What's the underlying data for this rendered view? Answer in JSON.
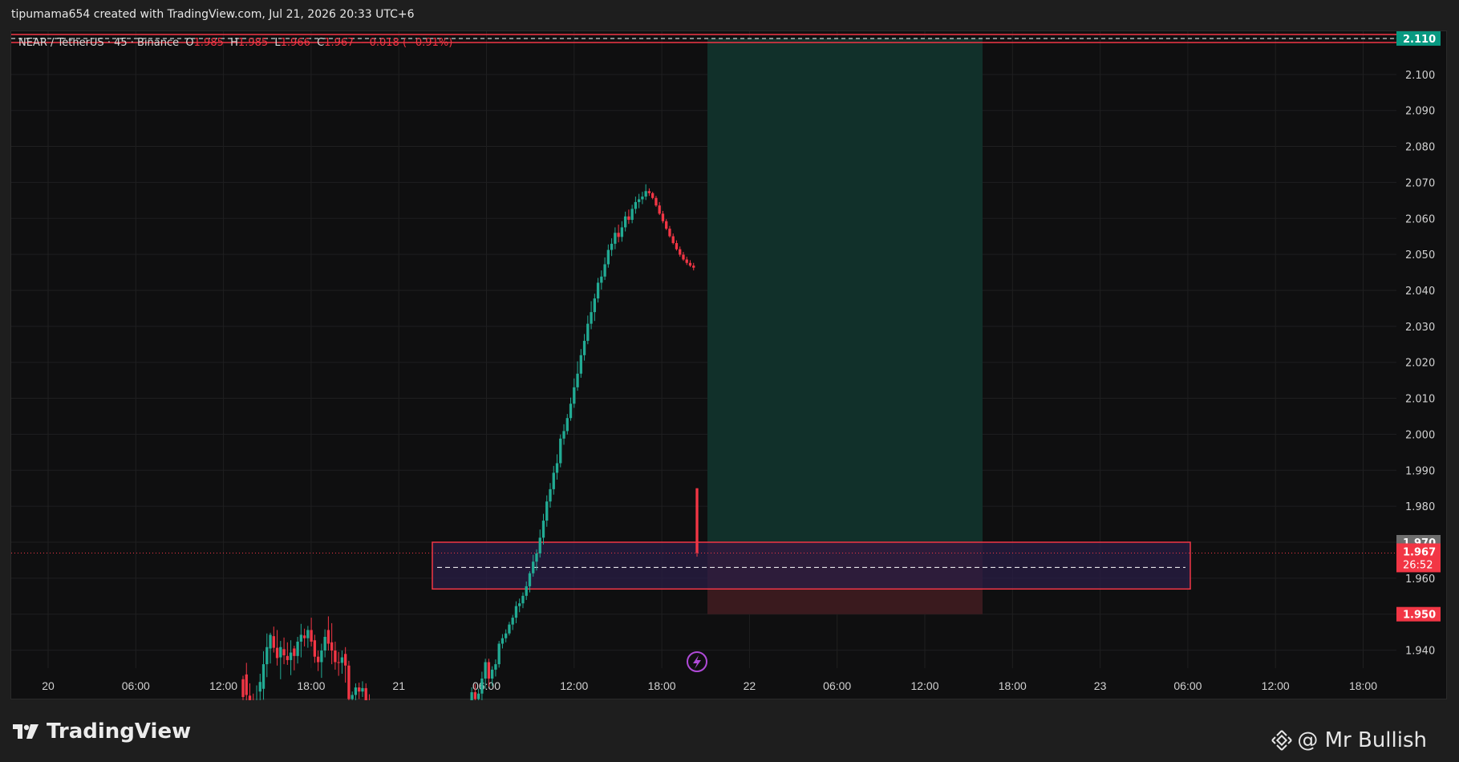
{
  "header": {
    "credit": "tipumama654 created with TradingView.com, Jul 21, 2026 20:33 UTC+6"
  },
  "legend": {
    "symbol": "NEAR / TetherUS · 45 · Binance",
    "open_label": "O",
    "open": "1.985",
    "high_label": "H",
    "high": "1.985",
    "low_label": "L",
    "low": "1.966",
    "close_label": "C",
    "close": "1.967",
    "change": "−0.018 (−0.91%)"
  },
  "footer": {
    "logo_text": "TradingView",
    "watermark": "@ Mr Bullish"
  },
  "colors": {
    "up": "#22ab94",
    "down": "#f23645",
    "bg": "#0f0f10",
    "grid": "#1f1f20",
    "target_zone": "#11302a",
    "stop_zone": "#3a1a1e",
    "box_border": "#f23645",
    "box_fill": "#2a1e44"
  },
  "chart_data": {
    "type": "candlestick",
    "symbol": "NEAR / TetherUS",
    "interval": "45",
    "exchange": "Binance",
    "ylim": [
      1.935,
      2.112
    ],
    "y_ticks": [
      "1.940",
      "1.950",
      "1.960",
      "1.970",
      "1.980",
      "1.990",
      "2.000",
      "2.010",
      "2.020",
      "2.030",
      "2.040",
      "2.050",
      "2.060",
      "2.070",
      "2.080",
      "2.090",
      "2.100",
      "2.110"
    ],
    "x_ticks": [
      "20",
      "06:00",
      "12:00",
      "18:00",
      "21",
      "06:00",
      "12:00",
      "18:00",
      "22",
      "06:00",
      "12:00",
      "18:00",
      "23",
      "06:00",
      "12:00",
      "18:00"
    ],
    "candles": [
      [
        1.9348,
        1.9353,
        1.9295,
        1.9322
      ],
      [
        1.9355,
        1.9372,
        1.9307,
        1.9325
      ],
      [
        1.9324,
        1.9342,
        1.9291,
        1.9313
      ],
      [
        1.9309,
        1.9327,
        1.9269,
        1.9294
      ],
      [
        1.9309,
        1.9339,
        1.9262,
        1.9313
      ],
      [
        1.933,
        1.9356,
        1.93,
        1.9344
      ],
      [
        1.9334,
        1.9389,
        1.9318,
        1.937
      ],
      [
        1.937,
        1.9415,
        1.9351,
        1.9395
      ],
      [
        1.9393,
        1.9416,
        1.9371,
        1.9413
      ],
      [
        1.9411,
        1.9425,
        1.9387,
        1.9394
      ],
      [
        1.9394,
        1.942,
        1.9368,
        1.9379
      ],
      [
        1.938,
        1.9404,
        1.9348,
        1.9395
      ],
      [
        1.9392,
        1.9409,
        1.937,
        1.9383
      ],
      [
        1.9382,
        1.9402,
        1.9369,
        1.9376
      ],
      [
        1.9376,
        1.9405,
        1.9354,
        1.9387
      ],
      [
        1.9393,
        1.9397,
        1.9361,
        1.9382
      ],
      [
        1.9382,
        1.941,
        1.9371,
        1.9403
      ],
      [
        1.9403,
        1.9429,
        1.938,
        1.9413
      ],
      [
        1.9412,
        1.9422,
        1.9396,
        1.9408
      ],
      [
        1.9408,
        1.9426,
        1.9394,
        1.942
      ],
      [
        1.942,
        1.9438,
        1.9396,
        1.9403
      ],
      [
        1.9405,
        1.9413,
        1.9372,
        1.9381
      ],
      [
        1.9381,
        1.939,
        1.936,
        1.9373
      ],
      [
        1.9373,
        1.94,
        1.935,
        1.939
      ],
      [
        1.939,
        1.9421,
        1.938,
        1.941
      ],
      [
        1.942,
        1.944,
        1.939,
        1.94
      ],
      [
        1.9402,
        1.943,
        1.937,
        1.939
      ],
      [
        1.939,
        1.9403,
        1.9362,
        1.9373
      ],
      [
        1.9373,
        1.9388,
        1.9353,
        1.9372
      ],
      [
        1.9372,
        1.939,
        1.9356,
        1.938
      ],
      [
        1.9385,
        1.9395,
        1.9343,
        1.9368
      ],
      [
        1.9368,
        1.9375,
        1.9317,
        1.9319
      ],
      [
        1.9319,
        1.933,
        1.931,
        1.9325
      ],
      [
        1.9325,
        1.9342,
        1.9316,
        1.9336
      ],
      [
        1.9336,
        1.9343,
        1.9319,
        1.933
      ],
      [
        1.933,
        1.9345,
        1.9322,
        1.9335
      ],
      [
        1.9335,
        1.9342,
        1.9303,
        1.9316
      ],
      [
        1.9316,
        1.9326,
        1.9296,
        1.93
      ],
      [
        1.93,
        1.9315,
        1.9283,
        1.9298
      ],
      [
        1.9298,
        1.9305,
        1.9268,
        1.929
      ],
      [
        1.929,
        1.9296,
        1.9263,
        1.9275
      ],
      [
        1.9275,
        1.9286,
        1.9258,
        1.9278
      ],
      [
        1.9284,
        1.9292,
        1.9265,
        1.927
      ],
      [
        1.927,
        1.9275,
        1.9236,
        1.9243
      ],
      [
        1.9243,
        1.9265,
        1.9235,
        1.9262
      ],
      [
        1.9262,
        1.9272,
        1.9255,
        1.926
      ],
      [
        1.926,
        1.9266,
        1.9228,
        1.9238
      ],
      [
        1.9238,
        1.9245,
        1.9211,
        1.9215
      ],
      [
        1.9208,
        1.9212,
        1.9193,
        1.9202
      ],
      [
        1.9202,
        1.921,
        1.9198,
        1.9205
      ],
      [
        1.9205,
        1.921,
        1.9195,
        1.9202
      ],
      [
        1.9202,
        1.9217,
        1.9198,
        1.9215
      ],
      [
        1.9215,
        1.9226,
        1.921,
        1.9222
      ],
      [
        1.9222,
        1.924,
        1.9216,
        1.9236
      ],
      [
        1.9236,
        1.9244,
        1.9216,
        1.922
      ],
      [
        1.922,
        1.923,
        1.9192,
        1.9195
      ],
      [
        1.9195,
        1.9215,
        1.9185,
        1.921
      ],
      [
        1.921,
        1.9242,
        1.92,
        1.9225
      ],
      [
        1.9225,
        1.926,
        1.9215,
        1.925
      ],
      [
        1.925,
        1.9258,
        1.923,
        1.9236
      ],
      [
        1.9236,
        1.9246,
        1.9218,
        1.9231
      ],
      [
        1.9231,
        1.926,
        1.9224,
        1.925
      ],
      [
        1.925,
        1.9281,
        1.9242,
        1.9272
      ],
      [
        1.9272,
        1.9296,
        1.9255,
        1.928
      ],
      [
        1.928,
        1.93,
        1.9275,
        1.929
      ],
      [
        1.929,
        1.9302,
        1.926,
        1.9268
      ],
      [
        1.9268,
        1.9297,
        1.9264,
        1.9293
      ],
      [
        1.9293,
        1.9336,
        1.9289,
        1.9329
      ],
      [
        1.9329,
        1.9341,
        1.9309,
        1.9319
      ],
      [
        1.9319,
        1.9334,
        1.9302,
        1.9327
      ],
      [
        1.9327,
        1.9359,
        1.9314,
        1.9349
      ],
      [
        1.9349,
        1.9378,
        1.9334,
        1.9373
      ],
      [
        1.9373,
        1.9378,
        1.9337,
        1.9349
      ],
      [
        1.9349,
        1.9367,
        1.9338,
        1.9362
      ],
      [
        1.9362,
        1.9377,
        1.9352,
        1.937
      ],
      [
        1.937,
        1.9404,
        1.9365,
        1.94
      ],
      [
        1.94,
        1.9414,
        1.9393,
        1.9408
      ],
      [
        1.9408,
        1.9421,
        1.9402,
        1.9415
      ],
      [
        1.9415,
        1.9432,
        1.9412,
        1.9428
      ],
      [
        1.9428,
        1.9442,
        1.942,
        1.9438
      ],
      [
        1.9438,
        1.9462,
        1.943,
        1.9455
      ],
      [
        1.9455,
        1.9466,
        1.9446,
        1.9459
      ],
      [
        1.9459,
        1.9475,
        1.9452,
        1.947
      ],
      [
        1.947,
        1.9491,
        1.9464,
        1.9484
      ],
      [
        1.9484,
        1.9506,
        1.9475,
        1.9503
      ],
      [
        1.9503,
        1.953,
        1.9498,
        1.952
      ],
      [
        1.952,
        1.9538,
        1.9507,
        1.9532
      ],
      [
        1.9532,
        1.9567,
        1.9526,
        1.9555
      ],
      [
        1.9555,
        1.959,
        1.9545,
        1.958
      ],
      [
        1.958,
        1.9617,
        1.9571,
        1.9608
      ],
      [
        1.9608,
        1.9635,
        1.9599,
        1.9626
      ],
      [
        1.9626,
        1.966,
        1.9618,
        1.965
      ],
      [
        1.965,
        1.9677,
        1.964,
        1.9664
      ],
      [
        1.9664,
        1.9706,
        1.9658,
        1.97
      ],
      [
        1.97,
        1.9721,
        1.9691,
        1.9711
      ],
      [
        1.9711,
        1.9736,
        1.9706,
        1.973
      ],
      [
        1.973,
        1.976,
        1.9726,
        1.9751
      ],
      [
        1.9751,
        1.9788,
        1.9745,
        1.9775
      ],
      [
        1.9775,
        1.9813,
        1.977,
        1.9795
      ],
      [
        1.9795,
        1.9831,
        1.9789,
        1.9822
      ],
      [
        1.9822,
        1.9853,
        1.9814,
        1.9843
      ],
      [
        1.9843,
        1.988,
        1.9838,
        1.9868
      ],
      [
        1.9868,
        1.9901,
        1.986,
        1.9885
      ],
      [
        1.9885,
        1.9912,
        1.9872,
        1.9905
      ],
      [
        1.9905,
        1.9935,
        1.9899,
        1.9928
      ],
      [
        1.9928,
        1.9946,
        1.9918,
        1.9937
      ],
      [
        1.9937,
        1.9965,
        1.9932,
        1.9955
      ],
      [
        1.9955,
        1.9984,
        1.995,
        1.9976
      ],
      [
        1.9976,
        1.9993,
        1.9967,
        1.9985
      ],
      [
        1.9985,
        2.0009,
        1.9977,
        2.0001
      ],
      [
        2.0001,
        2.0013,
        1.9987,
        1.9995
      ],
      [
        1.9995,
        2.0018,
        1.9988,
        2.0009
      ],
      [
        2.0009,
        2.0032,
        2.0003,
        2.0025
      ],
      [
        2.0025,
        2.0035,
        2.0014,
        2.002
      ],
      [
        2.002,
        2.0042,
        2.0015,
        2.0036
      ],
      [
        2.0036,
        2.0054,
        2.0029,
        2.0046
      ],
      [
        2.0046,
        2.0058,
        2.0037,
        2.005
      ],
      [
        2.005,
        2.0061,
        2.0043,
        2.0054
      ],
      [
        2.0054,
        2.0072,
        2.0049,
        2.0062
      ],
      [
        2.0062,
        2.0066,
        2.0055,
        2.0059
      ],
      [
        2.0059,
        2.0061,
        2.005,
        2.0052
      ],
      [
        2.0052,
        2.0055,
        2.0039,
        2.0041
      ],
      [
        2.0041,
        2.0046,
        2.0027,
        2.0029
      ],
      [
        2.0029,
        2.0033,
        2.0015,
        2.0018
      ],
      [
        2.0018,
        2.0021,
        2.0005,
        2.0007
      ],
      [
        2.0007,
        2.0011,
        1.9994,
        1.9996
      ],
      [
        1.9996,
        2.0,
        1.9984,
        1.9986
      ],
      [
        1.9986,
        1.999,
        1.9975,
        1.9977
      ],
      [
        1.9977,
        1.9981,
        1.9966,
        1.9969
      ],
      [
        1.9969,
        1.9973,
        1.996,
        1.9962
      ],
      [
        1.9962,
        1.9966,
        1.9954,
        1.9957
      ],
      [
        1.9957,
        1.9961,
        1.9951,
        1.9953
      ],
      [
        1.9953,
        1.9957,
        1.9946,
        1.995
      ],
      [
        1.985,
        1.985,
        1.9668,
        1.967
      ]
    ],
    "current_price": "1.967",
    "countdown": "26:52",
    "price_labels": {
      "target": "2.110",
      "entry": "1.970",
      "stop": "1.950"
    },
    "zones": {
      "target_top": 2.11,
      "entry": 1.97,
      "stop": 1.95
    },
    "demand_box": {
      "top": 1.97,
      "bottom": 1.957,
      "midline": 1.963
    }
  }
}
